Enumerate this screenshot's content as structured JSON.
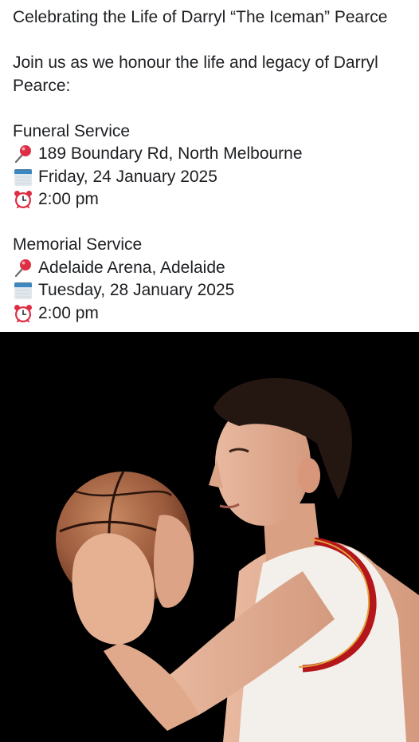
{
  "post": {
    "title": "Celebrating the Life of Darryl “The Iceman” Pearce",
    "intro": "Join us as we honour the life and legacy of Darryl Pearce:",
    "funeral": {
      "heading": "Funeral Service",
      "location": "189 Boundary Rd, North Melbourne",
      "date": "Friday, 24 January 2025",
      "time": "2:00 pm"
    },
    "memorial": {
      "heading": "Memorial Service",
      "location": "Adelaide Arena, Adelaide",
      "date": "Tuesday, 28 January 2025",
      "time": "2:00 pm"
    }
  },
  "icons": {
    "location": "round-pushpin-icon",
    "date": "calendar-icon",
    "time": "alarm-clock-icon"
  },
  "photo": {
    "subject": "basketball player in white jersey with red trim holding a basketball",
    "background_color": "#000000",
    "jersey_trim_color": "#b5161b"
  }
}
